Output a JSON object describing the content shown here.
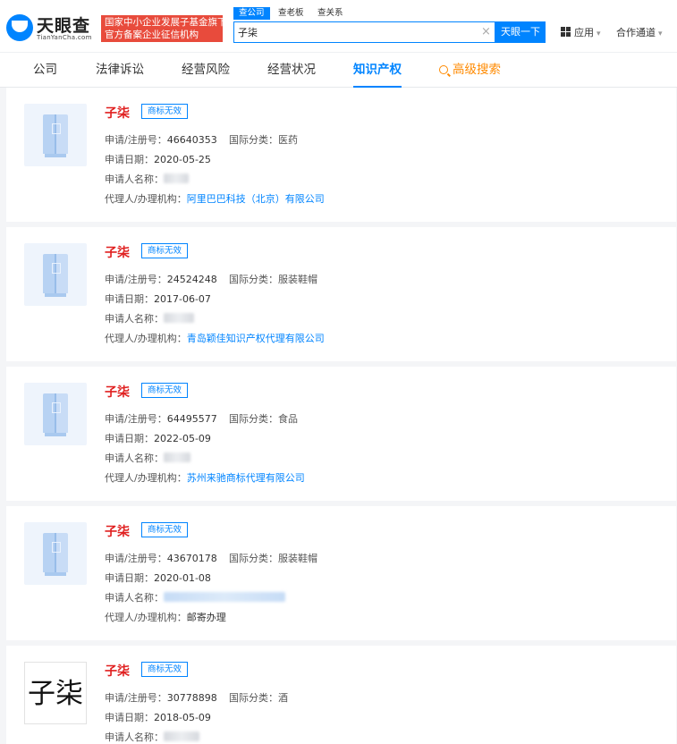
{
  "header": {
    "logo_text": "天眼查",
    "logo_sub": "TianYanCha.com",
    "slogan_line1": "国家中小企业发展子基金旗下",
    "slogan_line2": "官方备案企业征信机构",
    "search_tabs": [
      "查公司",
      "查老板",
      "查关系"
    ],
    "search_value": "子柒",
    "clear_symbol": "×",
    "search_button": "天眼一下",
    "app_menu": "应用",
    "partner_menu": "合作通道"
  },
  "nav": {
    "items": [
      "公司",
      "法律诉讼",
      "经营风险",
      "经营状况",
      "知识产权",
      "高级搜索"
    ],
    "active": "知识产权",
    "accent": "#0084ff",
    "advanced_color": "#ff8a00"
  },
  "labels": {
    "reg_no": "申请/注册号：",
    "intl_class": "国际分类：",
    "apply_date": "申请日期：",
    "applicant": "申请人名称：",
    "agent": "代理人/办理机构："
  },
  "trademarks": [
    {
      "name": "子柒",
      "status": "商标无效",
      "reg_no": "46640353",
      "intl_class": "医药",
      "apply_date": "2020-05-25",
      "agent": "阿里巴巴科技（北京）有限公司",
      "agent_is_link": true
    },
    {
      "name": "子柒",
      "status": "商标无效",
      "reg_no": "24524248",
      "intl_class": "服装鞋帽",
      "apply_date": "2017-06-07",
      "agent": "青岛颖佳知识产权代理有限公司",
      "agent_is_link": true
    },
    {
      "name": "子柒",
      "status": "商标无效",
      "reg_no": "64495577",
      "intl_class": "食品",
      "apply_date": "2022-05-09",
      "agent": "苏州来驰商标代理有限公司",
      "agent_is_link": true
    },
    {
      "name": "子柒",
      "status": "商标无效",
      "reg_no": "43670178",
      "intl_class": "服装鞋帽",
      "apply_date": "2020-01-08",
      "agent": "邮寄办理",
      "agent_is_link": false
    },
    {
      "name": "子柒",
      "status": "商标无效",
      "reg_no": "30778898",
      "intl_class": "酒",
      "apply_date": "2018-05-09",
      "agent": "",
      "agent_is_link": false,
      "image_text": "子柒"
    }
  ],
  "colors": {
    "name_red": "#e02020",
    "link_blue": "#0084ff",
    "slogan_red": "#e84b3c"
  }
}
